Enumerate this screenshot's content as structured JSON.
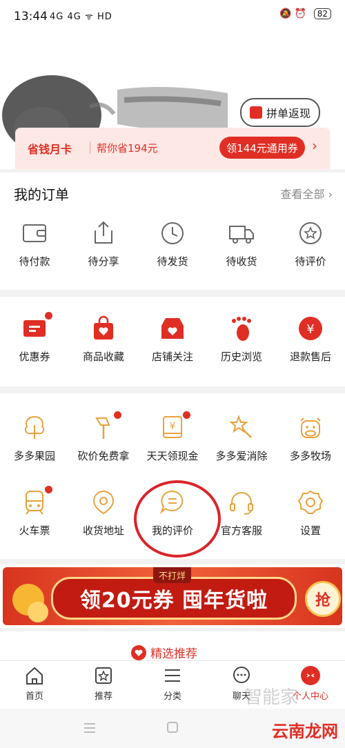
{
  "status": {
    "time": "13:44",
    "left_icons": "4G 4G ᯤ HD",
    "battery": "82"
  },
  "header": {
    "pindan_label": "拼单返现"
  },
  "savecard": {
    "title": "省钱月卡",
    "subtitle": "帮你省194元",
    "coupon_label": "领144元通用券",
    "arrow": "›"
  },
  "orders": {
    "title": "我的订单",
    "see_all": "查看全部 ›",
    "items": [
      {
        "label": "待付款",
        "icon": "wallet-icon"
      },
      {
        "label": "待分享",
        "icon": "share-icon"
      },
      {
        "label": "待发货",
        "icon": "clock-icon"
      },
      {
        "label": "待收货",
        "icon": "truck-icon"
      },
      {
        "label": "待评价",
        "icon": "star-bubble-icon"
      }
    ]
  },
  "services": {
    "items": [
      {
        "label": "优惠券",
        "icon": "coupon-icon",
        "dot": true
      },
      {
        "label": "商品收藏",
        "icon": "bag-heart-icon",
        "dot": false
      },
      {
        "label": "店铺关注",
        "icon": "store-heart-icon",
        "dot": false
      },
      {
        "label": "历史浏览",
        "icon": "footprint-icon",
        "dot": false
      },
      {
        "label": "退款售后",
        "icon": "yen-icon",
        "dot": false
      }
    ]
  },
  "tools": {
    "row1": [
      {
        "label": "多多果园",
        "icon": "tree-icon",
        "dot": false
      },
      {
        "label": "砍价免费拿",
        "icon": "axe-icon",
        "dot": true
      },
      {
        "label": "天天领现金",
        "icon": "cash-icon",
        "dot": true
      },
      {
        "label": "多多爱消除",
        "icon": "star-wand-icon",
        "dot": false
      },
      {
        "label": "多多牧场",
        "icon": "cow-icon",
        "dot": false
      }
    ],
    "row2": [
      {
        "label": "火车票",
        "icon": "train-icon",
        "dot": true
      },
      {
        "label": "收货地址",
        "icon": "location-icon",
        "dot": false
      },
      {
        "label": "我的评价",
        "icon": "comment-icon",
        "dot": false
      },
      {
        "label": "官方客服",
        "icon": "headset-icon",
        "dot": false
      },
      {
        "label": "设置",
        "icon": "gear-icon",
        "dot": false
      }
    ]
  },
  "banner": {
    "tag": "不打烊",
    "text": "领20元券 囤年货啦",
    "grab": "抢"
  },
  "recommend": {
    "label": "精选推荐"
  },
  "tabbar": {
    "items": [
      {
        "label": "首页",
        "icon": "home-icon"
      },
      {
        "label": "推荐",
        "icon": "star-tab-icon"
      },
      {
        "label": "分类",
        "icon": "list-icon"
      },
      {
        "label": "聊天",
        "icon": "chat-icon"
      },
      {
        "label": "个人中心",
        "icon": "profile-icon"
      }
    ]
  },
  "watermark": {
    "line1": "智能家",
    "line2": "云南龙网"
  },
  "colors": {
    "brand": "#e02e24",
    "icon_gray": "#666666",
    "icon_orange": "#e9a13b"
  }
}
